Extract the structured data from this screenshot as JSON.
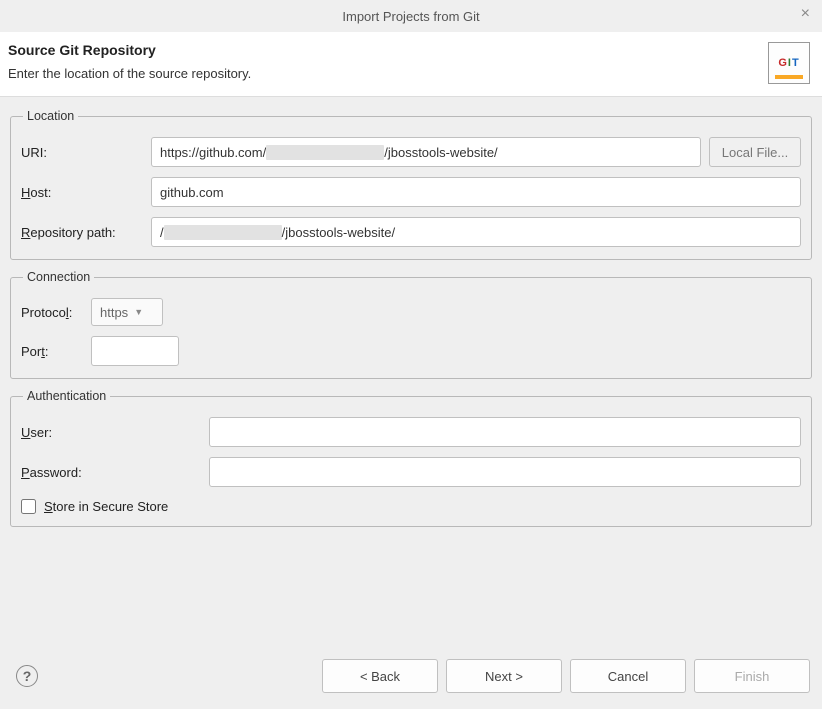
{
  "window": {
    "title": "Import Projects from Git",
    "close_label": "×"
  },
  "header": {
    "heading": "Source Git Repository",
    "subheading": "Enter the location of the source repository.",
    "git_icon_chars": {
      "g": "G",
      "i": "I",
      "t": "T"
    }
  },
  "location": {
    "legend": "Location",
    "uri_label": "URI:",
    "uri_prefix": "https://github.com/",
    "uri_redacted": "xxxxxxxxxxxxxx",
    "uri_suffix": "/jbosstools-website/",
    "local_file_btn": "Local File...",
    "host_label_prefix": "H",
    "host_label_suffix": "ost:",
    "host_value": "github.com",
    "repo_label_prefix": "R",
    "repo_label_suffix": "epository path:",
    "repo_prefix": "/",
    "repo_redacted": "xxxxxxxxxxxxxx",
    "repo_suffix": "/jbosstools-website/"
  },
  "connection": {
    "legend": "Connection",
    "protocol_label_prefix": "Protoco",
    "protocol_label_underlined": "l",
    "protocol_label_suffix": ":",
    "protocol_value": "https",
    "port_label_prefix": "Por",
    "port_label_underlined": "t",
    "port_label_suffix": ":",
    "port_value": ""
  },
  "auth": {
    "legend": "Authentication",
    "user_label_prefix": "U",
    "user_label_suffix": "ser:",
    "user_value": "",
    "password_label_prefix": "P",
    "password_label_suffix": "assword:",
    "password_value": "",
    "store_prefix": "S",
    "store_suffix": "tore in Secure Store",
    "store_checked": false
  },
  "footer": {
    "help": "?",
    "back": "< Back",
    "next": "Next >",
    "cancel": "Cancel",
    "finish": "Finish"
  }
}
